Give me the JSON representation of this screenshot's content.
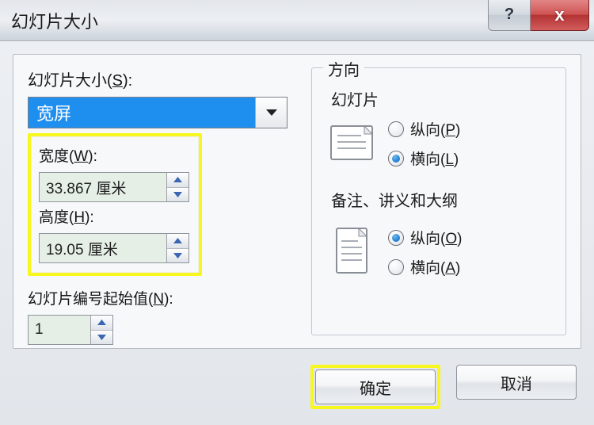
{
  "window": {
    "title": "幻灯片大小",
    "help_glyph": "?",
    "close_glyph": "x"
  },
  "left": {
    "size_label_start": "幻灯片大小(",
    "size_label_key": "S",
    "size_label_end": "):",
    "size_value": "宽屏",
    "width_label_start": "宽度(",
    "width_label_key": "W",
    "width_label_end": "):",
    "width_value": "33.867 厘米",
    "height_label_start": "高度(",
    "height_label_key": "H",
    "height_label_end": "):",
    "height_value": "19.05 厘米",
    "start_label_start": "幻灯片编号起始值(",
    "start_label_key": "N",
    "start_label_end": "):",
    "start_value": "1"
  },
  "right": {
    "legend": "方向",
    "slides_heading": "幻灯片",
    "notes_heading": "备注、讲义和大纲",
    "portrait_label_start": "纵向(",
    "portrait_key_P": "P",
    "landscape_label_start": "横向(",
    "landscape_key_L": "L",
    "portrait_key_O": "O",
    "landscape_key_A": "A",
    "paren_close": ")",
    "slides_selected": "landscape",
    "notes_selected": "portrait"
  },
  "buttons": {
    "ok": "确定",
    "cancel": "取消"
  }
}
